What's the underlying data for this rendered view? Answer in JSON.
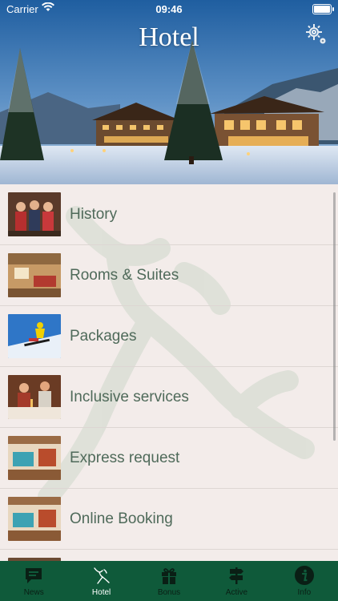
{
  "status_bar": {
    "carrier": "Carrier",
    "time": "09:46"
  },
  "header": {
    "title": "Hotel",
    "settings_icon": "gear-icon"
  },
  "menu": {
    "items": [
      {
        "label": "History",
        "icon": "family-photo"
      },
      {
        "label": "Rooms & Suites",
        "icon": "room-photo"
      },
      {
        "label": "Packages",
        "icon": "skier-photo"
      },
      {
        "label": "Inclusive services",
        "icon": "dinner-photo"
      },
      {
        "label": "Express request",
        "icon": "suite-photo"
      },
      {
        "label": "Online Booking",
        "icon": "suite-photo"
      }
    ]
  },
  "tabbar": {
    "tabs": [
      {
        "label": "News",
        "icon": "chat-bubble-icon"
      },
      {
        "label": "Hotel",
        "icon": "deer-icon",
        "active": true
      },
      {
        "label": "Bonus",
        "icon": "gift-icon"
      },
      {
        "label": "Active",
        "icon": "signpost-icon"
      },
      {
        "label": "Info",
        "icon": "info-icon"
      }
    ]
  },
  "colors": {
    "tabbar": "#0f5a3a",
    "label_text": "#4f6a5a",
    "list_bg": "#f3ecea"
  }
}
